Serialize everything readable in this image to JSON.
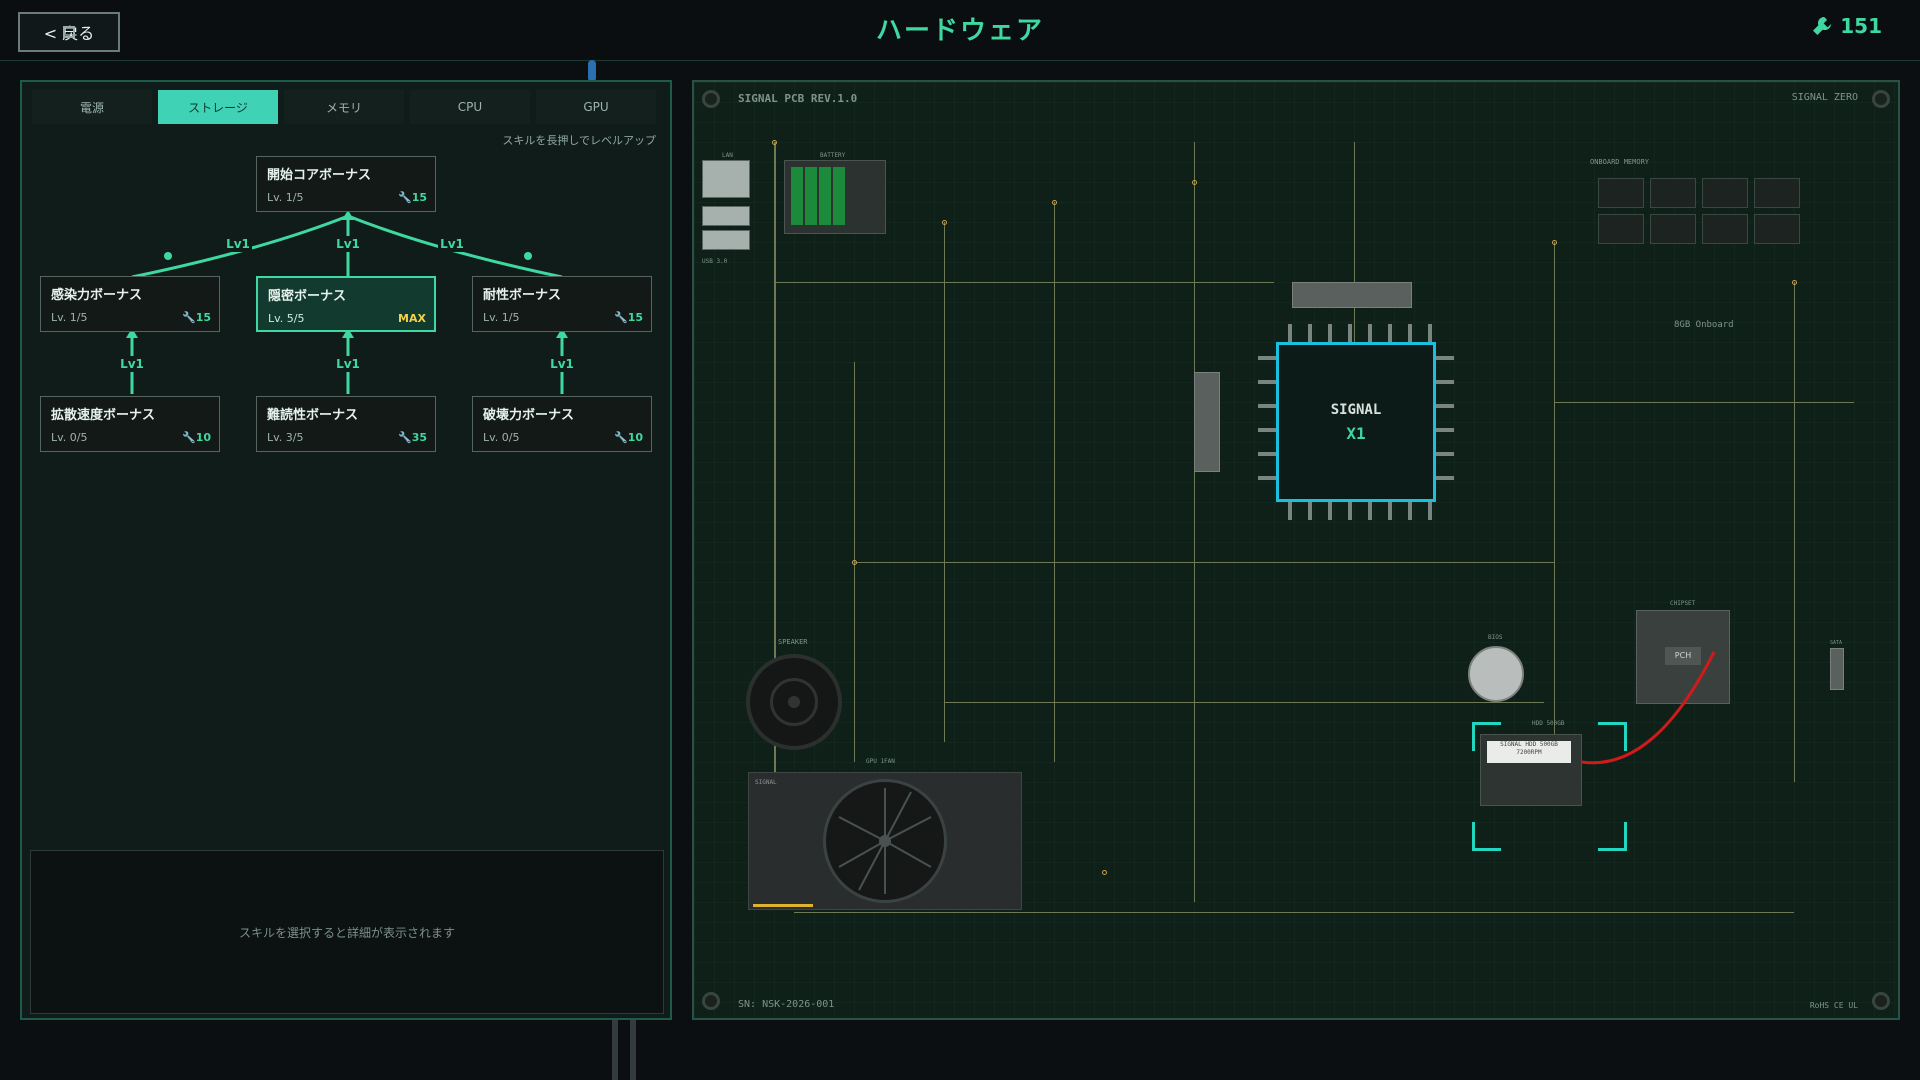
{
  "header": {
    "back_label": "< 戻る",
    "title": "ハードウェア",
    "currency_value": "151",
    "currency_icon": "wrench-icon"
  },
  "left_panel": {
    "tabs": [
      {
        "label": "電源",
        "active": false
      },
      {
        "label": "ストレージ",
        "active": true
      },
      {
        "label": "メモリ",
        "active": false
      },
      {
        "label": "CPU",
        "active": false
      },
      {
        "label": "GPU",
        "active": false
      }
    ],
    "hint": "スキルを長押しでレベルアップ",
    "connector_label": "Lv1",
    "skills": {
      "root": {
        "name": "開始コアボーナス",
        "level": "Lv. 1/5",
        "cost": "15"
      },
      "infect": {
        "name": "感染力ボーナス",
        "level": "Lv. 1/5",
        "cost": "15"
      },
      "stealth": {
        "name": "隠密ボーナス",
        "level": "Lv. 5/5",
        "cost": "MAX"
      },
      "durability": {
        "name": "耐性ボーナス",
        "level": "Lv. 1/5",
        "cost": "15"
      },
      "spread": {
        "name": "拡散速度ボーナス",
        "level": "Lv. 0/5",
        "cost": "10"
      },
      "decode": {
        "name": "難読性ボーナス",
        "level": "Lv. 3/5",
        "cost": "35"
      },
      "destroy": {
        "name": "破壊力ボーナス",
        "level": "Lv. 0/5",
        "cost": "10"
      }
    },
    "detail_placeholder": "スキルを選択すると詳細が表示されます"
  },
  "board": {
    "pcb_label": "SIGNAL PCB REV.1.0",
    "brand_label": "SIGNAL ZERO",
    "serial": "SN: NSK-2026-001",
    "cert": "RoHS CE UL",
    "battery_label": "BATTERY",
    "memory_label": "ONBOARD MEMORY",
    "memory_size": "8GB Onboard",
    "cpu_line1": "SIGNAL",
    "cpu_line2": "X1",
    "speaker_label": "SPEAKER",
    "gpu_label": "GPU 1FAN",
    "gpu_brand": "SIGNAL",
    "bios_label": "BIOS",
    "chipset_label": "CHIPSET",
    "chipset_inner": "PCH",
    "hdd_label": "HDD 500GB",
    "hdd_sticker": "SIGNAL HDD 500GB 7200RPM",
    "lan_label": "LAN",
    "usb_label": "USB 3.0",
    "sata_label": "SATA",
    "accent": "#3fd8a0",
    "cpu_border": "#19c0e0"
  }
}
